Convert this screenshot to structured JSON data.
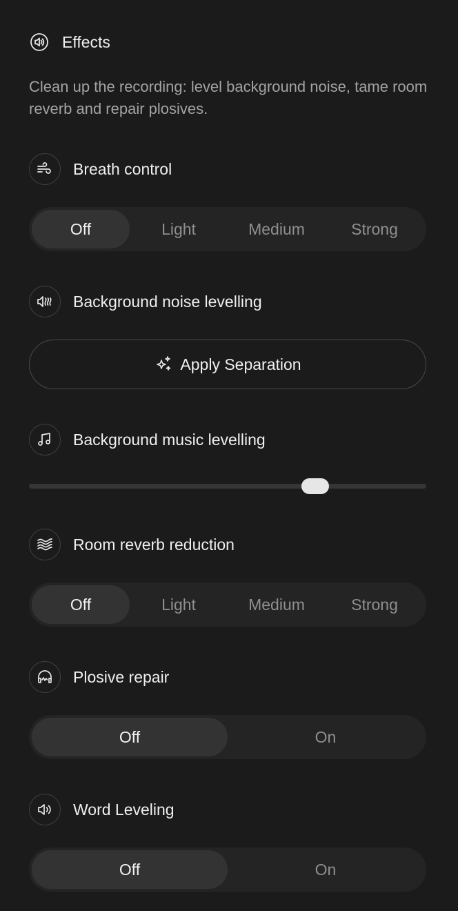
{
  "panel": {
    "title": "Effects",
    "title_icon": "speaker-circle-icon",
    "description": "Clean up the recording: level background noise, tame room reverb and repair plosives."
  },
  "breath_control": {
    "label": "Breath control",
    "icon": "wind-icon",
    "options": [
      "Off",
      "Light",
      "Medium",
      "Strong"
    ],
    "selected": "Off"
  },
  "noise_levelling": {
    "label": "Background noise levelling",
    "icon": "speaker-waves-icon",
    "button_label": "Apply Separation",
    "button_icon": "sparkles-icon"
  },
  "music_levelling": {
    "label": "Background music levelling",
    "icon": "music-note-icon",
    "slider_value": 0.72
  },
  "room_reverb": {
    "label": "Room reverb reduction",
    "icon": "waves-icon",
    "options": [
      "Off",
      "Light",
      "Medium",
      "Strong"
    ],
    "selected": "Off"
  },
  "plosive_repair": {
    "label": "Plosive repair",
    "icon": "headphones-icon",
    "options": [
      "Off",
      "On"
    ],
    "selected": "Off"
  },
  "word_leveling": {
    "label": "Word Leveling",
    "icon": "speaker-icon",
    "options": [
      "Off",
      "On"
    ],
    "selected": "Off"
  },
  "colors": {
    "background": "#1b1b1b",
    "control_bg": "#242424",
    "active_segment": "#333333",
    "text_primary": "#efefef",
    "text_muted": "#8f8f8f",
    "slider_thumb": "#e6e6e6"
  }
}
